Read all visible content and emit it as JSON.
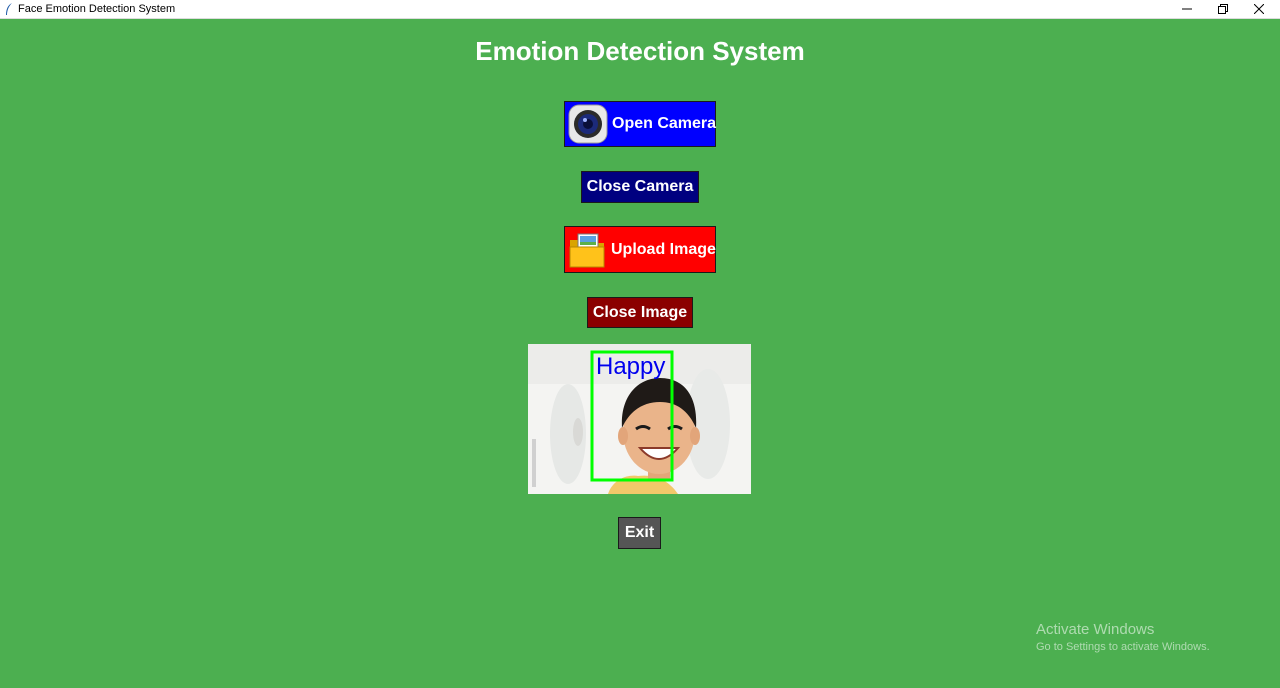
{
  "window": {
    "title": "Face Emotion Detection System",
    "controls": [
      "minimize-icon",
      "maximize-icon",
      "close-icon"
    ]
  },
  "main": {
    "heading": "Emotion Detection System",
    "buttons": {
      "open_camera": {
        "label": "Open Camera",
        "icon": "camera-icon",
        "color": "#0000ff"
      },
      "close_camera": {
        "label": "Close Camera",
        "color": "#000080"
      },
      "upload_image": {
        "label": "Upload Image",
        "icon": "folder-image-icon",
        "color": "#ff0000"
      },
      "close_image": {
        "label": "Close Image",
        "color": "#8b0000"
      },
      "exit": {
        "label": "Exit",
        "color": "#555555"
      }
    },
    "preview": {
      "detected_emotion": "Happy",
      "box_color": "#00ff00",
      "label_color": "#0000ee"
    }
  },
  "os_overlay": {
    "line1": "Activate Windows",
    "line2": "Go to Settings to activate Windows."
  },
  "colors": {
    "background": "#4caf50"
  }
}
